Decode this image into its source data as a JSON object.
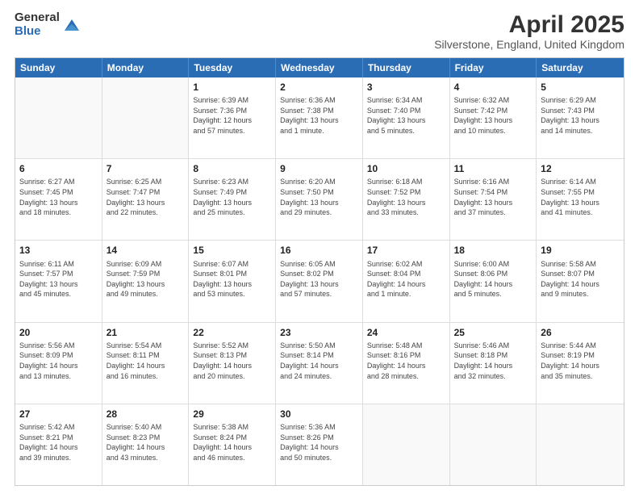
{
  "logo": {
    "general": "General",
    "blue": "Blue"
  },
  "title": "April 2025",
  "subtitle": "Silverstone, England, United Kingdom",
  "days": [
    "Sunday",
    "Monday",
    "Tuesday",
    "Wednesday",
    "Thursday",
    "Friday",
    "Saturday"
  ],
  "weeks": [
    [
      {
        "day": "",
        "info": ""
      },
      {
        "day": "",
        "info": ""
      },
      {
        "day": "1",
        "info": "Sunrise: 6:39 AM\nSunset: 7:36 PM\nDaylight: 12 hours\nand 57 minutes."
      },
      {
        "day": "2",
        "info": "Sunrise: 6:36 AM\nSunset: 7:38 PM\nDaylight: 13 hours\nand 1 minute."
      },
      {
        "day": "3",
        "info": "Sunrise: 6:34 AM\nSunset: 7:40 PM\nDaylight: 13 hours\nand 5 minutes."
      },
      {
        "day": "4",
        "info": "Sunrise: 6:32 AM\nSunset: 7:42 PM\nDaylight: 13 hours\nand 10 minutes."
      },
      {
        "day": "5",
        "info": "Sunrise: 6:29 AM\nSunset: 7:43 PM\nDaylight: 13 hours\nand 14 minutes."
      }
    ],
    [
      {
        "day": "6",
        "info": "Sunrise: 6:27 AM\nSunset: 7:45 PM\nDaylight: 13 hours\nand 18 minutes."
      },
      {
        "day": "7",
        "info": "Sunrise: 6:25 AM\nSunset: 7:47 PM\nDaylight: 13 hours\nand 22 minutes."
      },
      {
        "day": "8",
        "info": "Sunrise: 6:23 AM\nSunset: 7:49 PM\nDaylight: 13 hours\nand 25 minutes."
      },
      {
        "day": "9",
        "info": "Sunrise: 6:20 AM\nSunset: 7:50 PM\nDaylight: 13 hours\nand 29 minutes."
      },
      {
        "day": "10",
        "info": "Sunrise: 6:18 AM\nSunset: 7:52 PM\nDaylight: 13 hours\nand 33 minutes."
      },
      {
        "day": "11",
        "info": "Sunrise: 6:16 AM\nSunset: 7:54 PM\nDaylight: 13 hours\nand 37 minutes."
      },
      {
        "day": "12",
        "info": "Sunrise: 6:14 AM\nSunset: 7:55 PM\nDaylight: 13 hours\nand 41 minutes."
      }
    ],
    [
      {
        "day": "13",
        "info": "Sunrise: 6:11 AM\nSunset: 7:57 PM\nDaylight: 13 hours\nand 45 minutes."
      },
      {
        "day": "14",
        "info": "Sunrise: 6:09 AM\nSunset: 7:59 PM\nDaylight: 13 hours\nand 49 minutes."
      },
      {
        "day": "15",
        "info": "Sunrise: 6:07 AM\nSunset: 8:01 PM\nDaylight: 13 hours\nand 53 minutes."
      },
      {
        "day": "16",
        "info": "Sunrise: 6:05 AM\nSunset: 8:02 PM\nDaylight: 13 hours\nand 57 minutes."
      },
      {
        "day": "17",
        "info": "Sunrise: 6:02 AM\nSunset: 8:04 PM\nDaylight: 14 hours\nand 1 minute."
      },
      {
        "day": "18",
        "info": "Sunrise: 6:00 AM\nSunset: 8:06 PM\nDaylight: 14 hours\nand 5 minutes."
      },
      {
        "day": "19",
        "info": "Sunrise: 5:58 AM\nSunset: 8:07 PM\nDaylight: 14 hours\nand 9 minutes."
      }
    ],
    [
      {
        "day": "20",
        "info": "Sunrise: 5:56 AM\nSunset: 8:09 PM\nDaylight: 14 hours\nand 13 minutes."
      },
      {
        "day": "21",
        "info": "Sunrise: 5:54 AM\nSunset: 8:11 PM\nDaylight: 14 hours\nand 16 minutes."
      },
      {
        "day": "22",
        "info": "Sunrise: 5:52 AM\nSunset: 8:13 PM\nDaylight: 14 hours\nand 20 minutes."
      },
      {
        "day": "23",
        "info": "Sunrise: 5:50 AM\nSunset: 8:14 PM\nDaylight: 14 hours\nand 24 minutes."
      },
      {
        "day": "24",
        "info": "Sunrise: 5:48 AM\nSunset: 8:16 PM\nDaylight: 14 hours\nand 28 minutes."
      },
      {
        "day": "25",
        "info": "Sunrise: 5:46 AM\nSunset: 8:18 PM\nDaylight: 14 hours\nand 32 minutes."
      },
      {
        "day": "26",
        "info": "Sunrise: 5:44 AM\nSunset: 8:19 PM\nDaylight: 14 hours\nand 35 minutes."
      }
    ],
    [
      {
        "day": "27",
        "info": "Sunrise: 5:42 AM\nSunset: 8:21 PM\nDaylight: 14 hours\nand 39 minutes."
      },
      {
        "day": "28",
        "info": "Sunrise: 5:40 AM\nSunset: 8:23 PM\nDaylight: 14 hours\nand 43 minutes."
      },
      {
        "day": "29",
        "info": "Sunrise: 5:38 AM\nSunset: 8:24 PM\nDaylight: 14 hours\nand 46 minutes."
      },
      {
        "day": "30",
        "info": "Sunrise: 5:36 AM\nSunset: 8:26 PM\nDaylight: 14 hours\nand 50 minutes."
      },
      {
        "day": "",
        "info": ""
      },
      {
        "day": "",
        "info": ""
      },
      {
        "day": "",
        "info": ""
      }
    ]
  ]
}
